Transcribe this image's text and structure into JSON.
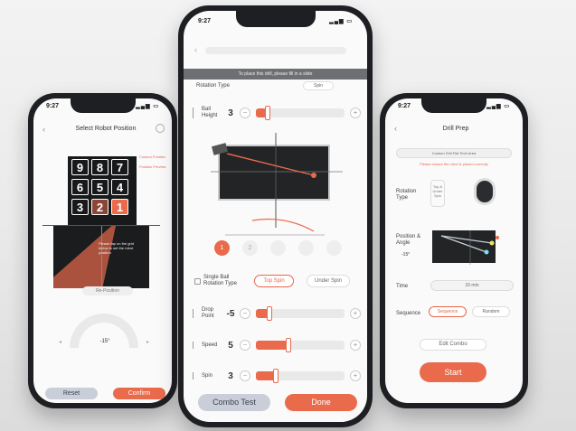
{
  "left_phone": {
    "time": "9:27",
    "title": "Select Robot Position",
    "keys": [
      "9",
      "8",
      "7",
      "6",
      "5",
      "4",
      "3",
      "2",
      "1"
    ],
    "legend": [
      "Custom Position",
      "Position Preview"
    ],
    "instruction": "Please tap on the grid below to set the robot position",
    "reposition_label": "Re-Position",
    "angle": "-15°",
    "reset_label": "Reset",
    "confirm_label": "Confirm"
  },
  "center_phone": {
    "time": "9:27",
    "banner": "To place this drill, please fill in a slide",
    "rotation_type_label": "Rotation Type",
    "spin_value": "Spin",
    "ball_height_label": "Ball Height",
    "ball_height": "3",
    "balls": [
      "1",
      "2",
      "3",
      "4",
      "5"
    ],
    "single_ball_label": "Single Ball Rotation Type",
    "top_spin_label": "Top Spin",
    "under_spin_label": "Under Spin",
    "drop_point_label": "Drop Point",
    "drop_point": "-5",
    "speed_label": "Speed",
    "speed": "5",
    "spin_label": "Spin",
    "spin": "3",
    "combo_test_label": "Combo Test",
    "done_label": "Done"
  },
  "right_phone": {
    "time": "9:27",
    "title": "Drill Prep",
    "dropdown": "Custom Drill Flat Tech Area",
    "note": "Please ensure the robot is placed correctly",
    "rotation_type_label": "Rotation Type",
    "rotation_values": "Top & Under Spin",
    "position_label": "Position & Angle",
    "angle": "-15°",
    "time_label": "Time",
    "time_value": "10 min",
    "sequence_label": "Sequence",
    "sequence_opt1": "Sequence",
    "sequence_opt2": "Random",
    "edit_combo_label": "Edit Combo",
    "start_label": "Start"
  },
  "colors": {
    "accent": "#ea6a4c",
    "phone": "#1d1f22",
    "court": "#222426"
  }
}
